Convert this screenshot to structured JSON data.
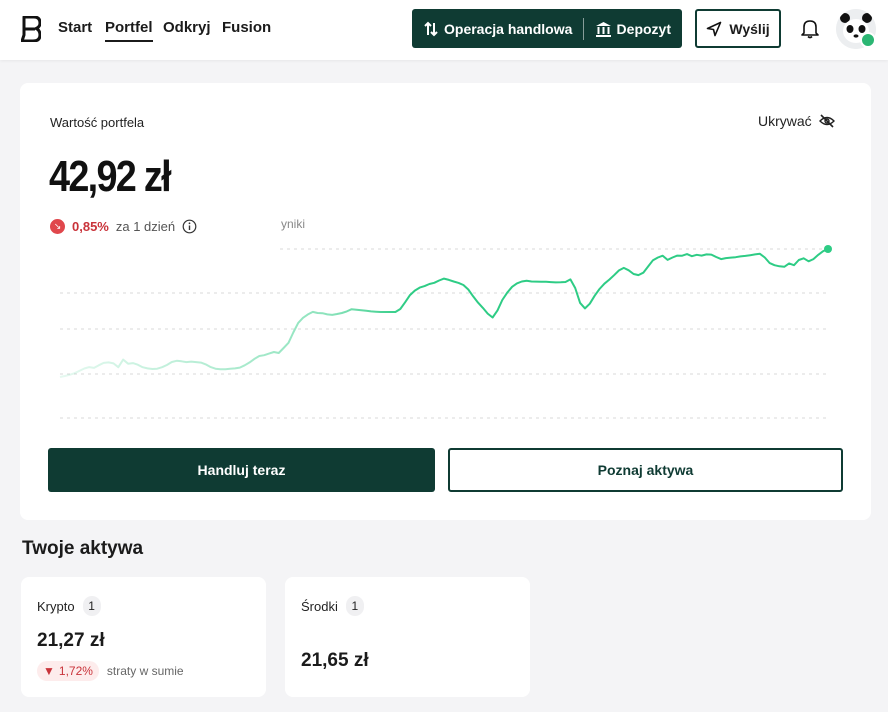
{
  "nav": {
    "items": [
      {
        "label": "Start",
        "active": false
      },
      {
        "label": "Portfel",
        "active": true
      },
      {
        "label": "Odkryj",
        "active": false
      },
      {
        "label": "Fusion",
        "active": false
      }
    ]
  },
  "header": {
    "trade_label": "Operacja handlowa",
    "deposit_label": "Depozyt",
    "send_label": "Wyślij",
    "icons": [
      "swap-arrows-icon",
      "bank-icon",
      "send-icon",
      "bell-icon",
      "panda-avatar",
      "verified-icon"
    ]
  },
  "portfolio": {
    "label": "Wartość portfela",
    "hide_label": "Ukrywać",
    "value": "42,92 zł",
    "change_pct": "0,85%",
    "change_period": "za 1 dzień",
    "chart_overlay_text": "yniki",
    "trade_now_label": "Handluj teraz",
    "explore_label": "Poznaj aktywa"
  },
  "assets": {
    "title": "Twoje aktywa",
    "cards": [
      {
        "name": "Krypto",
        "count": "1",
        "value": "21,27 zł",
        "loss_pct": "1,72%",
        "loss_text": "straty w sumie"
      },
      {
        "name": "Środki",
        "count": "1",
        "value": "21,65 zł"
      }
    ]
  },
  "colors": {
    "brand_dark": "#0f3b33",
    "chart_line": "#2ecc85",
    "loss_red": "#c9333a"
  },
  "chart_data": {
    "type": "line",
    "title": "",
    "xlabel": "",
    "ylabel": "",
    "grid": true,
    "series": [
      {
        "values": [
          20.0,
          20.6,
          21.4,
          22.4,
          23.8,
          25.3,
          26.2,
          25.7,
          27.4,
          28.8,
          29.1,
          28.5,
          26.1,
          30.9,
          28.3,
          28.7,
          27.7,
          26.1,
          25.4,
          25.0,
          25.2,
          26.1,
          27.5,
          29.4,
          30.1,
          29.8,
          29.3,
          29.6,
          29.3,
          29.0,
          27.9,
          26.2,
          25.2,
          24.8,
          24.8,
          25.1,
          25.4,
          25.9,
          27.3,
          29.1,
          31.3,
          33.1,
          33.6,
          34.6,
          35.6,
          35.0,
          38.1,
          41.4,
          47.8,
          53.8,
          57.0,
          59.1,
          60.7,
          60.0,
          59.9,
          59.1,
          58.8,
          59.4,
          60.0,
          61.0,
          62.4,
          62.0,
          61.7,
          61.4,
          61.0,
          60.8,
          60.6,
          60.6,
          60.6,
          60.6,
          62.5,
          66.7,
          71.2,
          74.0,
          75.9,
          76.8,
          78.1,
          78.9,
          80.3,
          81.5,
          80.7,
          79.7,
          78.8,
          77.5,
          74.7,
          70.4,
          66.5,
          63.2,
          59.6,
          57.2,
          61.6,
          68.1,
          72.7,
          76.4,
          78.5,
          79.7,
          80.1,
          79.7,
          79.6,
          79.5,
          79.5,
          79.3,
          79.1,
          79.2,
          79.4,
          81.0,
          75.6,
          66.3,
          62.9,
          65.8,
          70.8,
          75.0,
          78.3,
          80.9,
          83.6,
          86.6,
          88.2,
          86.7,
          84.4,
          83.7,
          85.2,
          89.1,
          93.0,
          94.7,
          95.8,
          93.2,
          94.7,
          95.9,
          95.8,
          96.8,
          95.5,
          96.4,
          95.9,
          96.6,
          96.5,
          95.0,
          93.7,
          94.3,
          94.6,
          94.9,
          95.4,
          95.7,
          96.1,
          96.6,
          97.0,
          94.7,
          91.2,
          89.9,
          89.2,
          88.9,
          91.0,
          89.9,
          93.1,
          94.2,
          92.3,
          93.7,
          96.4,
          98.6,
          100.0
        ]
      }
    ]
  }
}
